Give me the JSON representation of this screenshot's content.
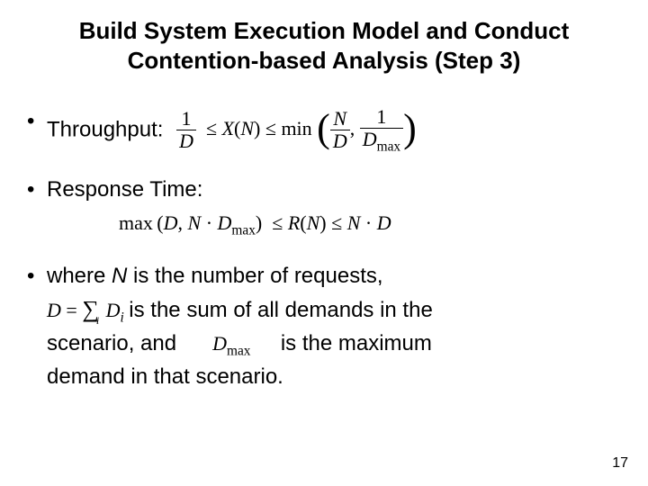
{
  "title_line1": "Build System Execution Model and Conduct",
  "title_line2": "Contention-based Analysis (Step 3)",
  "bullets": {
    "throughput_label": "Throughput:",
    "response_label": "Response Time:",
    "where_part1": "where ",
    "N": "N",
    "where_part2": " is the number of requests,",
    "def_part1": " is the sum of all demands in the",
    "def_part2a": "scenario, and",
    "def_part2b": "is the maximum",
    "def_part3": "demand in that scenario."
  },
  "math": {
    "one": "1",
    "D": "D",
    "N_sym": "N",
    "Dmax": "D",
    "max_sub": "max",
    "leq": "≤",
    "X": "X",
    "R": "R",
    "min": "min",
    "max_fn": "max",
    "cdot": "·",
    "comma": ",",
    "lp": "(",
    "rp": ")",
    "eq": "=",
    "sum_sym": "∑",
    "Di": "D",
    "i_sub": "i"
  },
  "page_number": "17"
}
